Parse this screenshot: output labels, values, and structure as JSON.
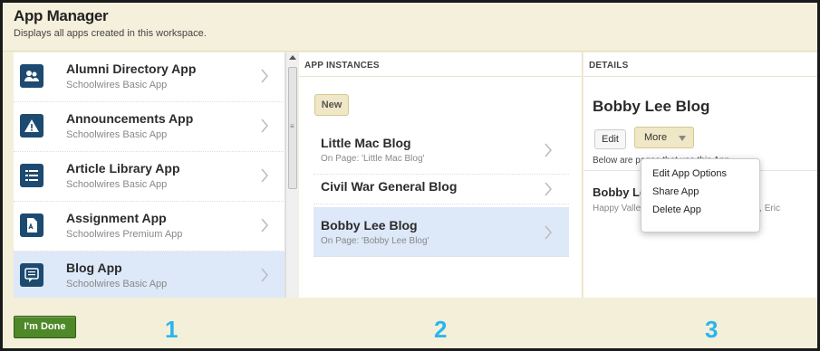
{
  "header": {
    "title": "App Manager",
    "subtitle": "Displays all apps created in this workspace."
  },
  "apps": [
    {
      "name": "Alumni Directory App",
      "type": "Schoolwires Basic App",
      "icon": "people-icon"
    },
    {
      "name": "Announcements App",
      "type": "Schoolwires Basic App",
      "icon": "warning-icon"
    },
    {
      "name": "Article Library App",
      "type": "Schoolwires Basic App",
      "icon": "list-icon"
    },
    {
      "name": "Assignment App",
      "type": "Schoolwires Premium App",
      "icon": "document-icon"
    },
    {
      "name": "Blog App",
      "type": "Schoolwires Basic App",
      "icon": "chat-icon"
    }
  ],
  "instances": {
    "header": "APP INSTANCES",
    "new_label": "New",
    "items": [
      {
        "name": "Little Mac Blog",
        "page": "On Page: 'Little Mac Blog'"
      },
      {
        "name": "Civil War General Blog",
        "page": ""
      },
      {
        "name": "Bobby Lee Blog",
        "page": "On Page: 'Bobby Lee Blog'"
      }
    ]
  },
  "details": {
    "header": "DETAILS",
    "title": "Bobby Lee Blog",
    "edit_label": "Edit",
    "more_label": "More",
    "below_text": "Below are pages that use this App",
    "item_name": "Bobby Lee Blog",
    "item_info": "Happy Valley Elementary School | Sparks, Eric"
  },
  "more_menu": [
    "Edit App Options",
    "Share App",
    "Delete App"
  ],
  "footer": {
    "done_label": "I'm Done",
    "steps": [
      "1",
      "2",
      "3"
    ]
  },
  "colors": {
    "selected_bg": "#dde8f8",
    "done_green": "#4e8828",
    "step_blue": "#29b6f0",
    "icon_navy": "#1c4a70"
  }
}
